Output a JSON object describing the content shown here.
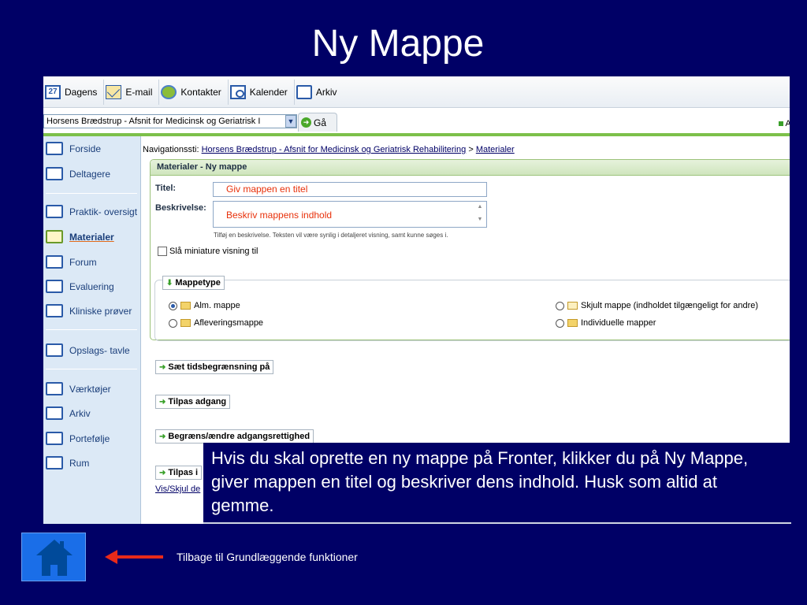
{
  "slide": {
    "title": "Ny Mappe",
    "caption": "Hvis du skal oprette en ny mappe på Fronter, klikker du på Ny Mappe, giver mappen en titel og beskriver dens indhold. Husk som altid at gemme.",
    "back_link": "Tilbage til Grundlæggende funktioner"
  },
  "toolbar": {
    "calendar_day": "27",
    "items": [
      "Dagens",
      "E-mail",
      "Kontakter",
      "Kalender",
      "Arkiv"
    ]
  },
  "address": {
    "room": "Horsens Brædstrup - Afsnit for Medicinsk og Geriatrisk I",
    "go_label": "Gå",
    "right_label": "Ad"
  },
  "sidebar": {
    "items": [
      "Forside",
      "Deltagere",
      "Praktik- oversigt",
      "Materialer",
      "Forum",
      "Evaluering",
      "Kliniske prøver",
      "Opslags- tavle",
      "Værktøjer",
      "Arkiv",
      "Portefølje",
      "Rum"
    ],
    "active": "Materialer"
  },
  "nav": {
    "prefix": "Navigationssti:",
    "crumb1": "Horsens Brædstrup - Afsnit for Medicinsk og Geriatrisk Rehabilitering",
    "separator": ">",
    "crumb2": "Materialer"
  },
  "form": {
    "header": "Materialer - Ny mappe",
    "title_label": "Titel:",
    "title_value": "Giv mappen en titel",
    "desc_label": "Beskrivelse:",
    "desc_value": "Beskriv mappens indhold",
    "desc_hint": "Tilføj en beskrivelse. Teksten vil være synlig i detaljeret visning, samt kunne søges i.",
    "thumbnail_label": "Slå miniature visning til",
    "mappetype_label": "Mappetype",
    "types": {
      "alm": "Alm. mappe",
      "aflevering": "Afleveringsmappe",
      "skjult": "Skjult mappe (indholdet tilgængeligt for andre)",
      "individuelle": "Individuelle mapper"
    },
    "sections": [
      "Sæt tidsbegrænsning på",
      "Tilpas adgang",
      "Begræns/ændre adgangsrettighed",
      "Tilpas i"
    ],
    "vis_skjul": "Vis/Skjul de"
  },
  "colors": {
    "slide_bg": "#000066",
    "accent_green": "#7cc04a",
    "input_text": "#e8300a"
  }
}
